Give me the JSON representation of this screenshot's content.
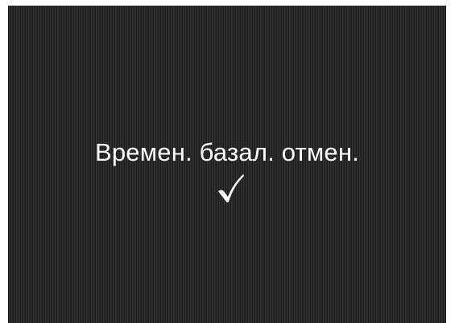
{
  "screen": {
    "message": "Времен. базал. отмен.",
    "confirm_icon": "checkmark-icon",
    "background_color": "#2a2a2a",
    "text_color": "#ffffff"
  }
}
